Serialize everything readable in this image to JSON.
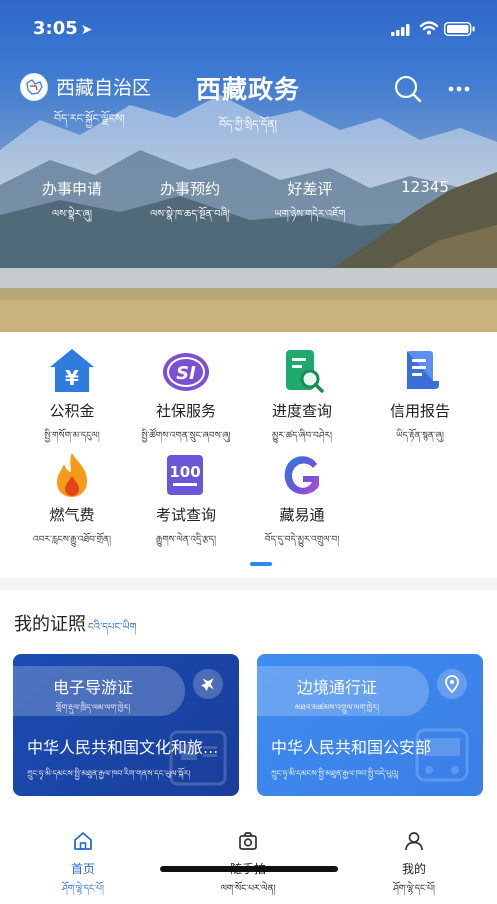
{
  "status_bar": {
    "time": "3:05"
  },
  "header": {
    "region_name": "西藏自治区",
    "region_sub": "བོད་རང་སྐྱོང་ལྗོངས།",
    "app_title": "西藏政务",
    "app_title_sub": "བོད་ཀྱི་སྲིད་དོན།",
    "search_icon": "search-icon",
    "more_icon": "more-icon"
  },
  "quick_links": [
    {
      "label": "办事申请",
      "sub": "ལས་སྣེར་ཞུ།"
    },
    {
      "label": "办事预约",
      "sub": "ལས་སྣེ་ཁ་ཆད་སྔོན་བཞི།"
    },
    {
      "label": "好差评",
      "sub": "ཡག་ཉེས་གདེར་འཇོག"
    },
    {
      "label": "12345",
      "sub": ""
    }
  ],
  "services": [
    {
      "label": "公积金",
      "sub": "སྤྱི་གསོག་མ་དངུལ།",
      "icon": "housing-fund-icon"
    },
    {
      "label": "社保服务",
      "sub": "སྤྱི་ཚོགས་འགན་སྲུང་ཞབས་ཞུ།",
      "icon": "social-security-icon"
    },
    {
      "label": "进度查询",
      "sub": "མྱུར་ཚད་ཞིབ་བཤེར།",
      "icon": "progress-query-icon"
    },
    {
      "label": "信用报告",
      "sub": "ཡིད་རྟོན་སྙན་ཞུ།",
      "icon": "credit-report-icon"
    },
    {
      "label": "燃气费",
      "sub": "འབར་རླངས་རྒྱུ་འཐོབ་གྲོན།",
      "icon": "gas-fee-icon"
    },
    {
      "label": "考试查询",
      "sub": "རྒྱུགས་ལེན་འདྲི་རྩད།",
      "icon": "exam-query-icon"
    },
    {
      "label": "藏易通",
      "sub": "བོད་དུ་བདེ་མྱུར་འགྲུལ་བ།",
      "icon": "zangyitong-icon"
    }
  ],
  "certificates": {
    "title": "我的证照",
    "title_sub": "ངའི་དཔང་ཡིག",
    "cards": [
      {
        "name": "电子导游证",
        "name_sub": "གློག་རྡུལ་ཁྲིད་ལམ་ལག་ཁྱེར།",
        "org": "中华人民共和国文化和旅...",
        "org_sub": "ཀྲུང་ཧྭ་མི་དམངས་སྤྱི་མཐུན་རྒྱལ་ཁབ་རིག་གནས་དང་ཡུལ་སྐོར།",
        "icon": "airplane-icon",
        "color": "#1b4db3"
      },
      {
        "name": "边境通行证",
        "name_sub": "མཐའ་མཚམས་འགྲུལ་ལག་ཁྱེར།",
        "org": "中华人民共和国公安部",
        "org_sub": "ཀྲུང་ཧྭ་མི་དམངས་སྤྱི་མཐུན་རྒྱལ་ཁབ་སྤྱི་བདེ་པུའུ།",
        "icon": "location-pin-icon",
        "color": "#3f8cf0"
      }
    ]
  },
  "tabbar": [
    {
      "label": "首页",
      "sub": "ཤོག་ལྷེ་དང་པོ།",
      "active": true,
      "icon": "home-icon"
    },
    {
      "label": "随手拍",
      "sub": "ལག་སོང་པར་ལེན།",
      "active": false,
      "icon": "camera-icon"
    },
    {
      "label": "我的",
      "sub": "ཤོག་ལྷེ་དང་པོ།",
      "active": false,
      "icon": "person-icon"
    }
  ],
  "colors": {
    "primary": "#2a6ad6",
    "card_dark": "#1b4db3",
    "card_light": "#3f8cf0"
  }
}
